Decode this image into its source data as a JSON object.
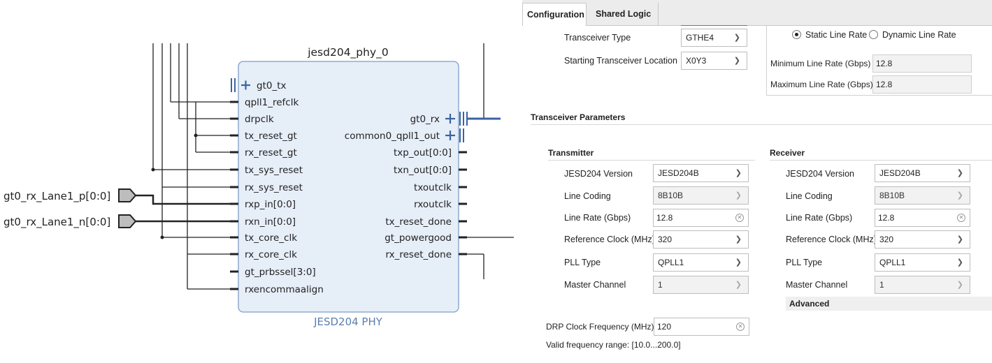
{
  "diagram": {
    "block_title": "jesd204_phy_0",
    "block_caption": "JESD204 PHY",
    "external_inputs": [
      "gt0_rx_Lane1_p[0:0]",
      "gt0_rx_Lane1_n[0:0]"
    ],
    "left_ports": [
      "gt0_tx",
      "qpll1_refclk",
      "drpclk",
      "tx_reset_gt",
      "rx_reset_gt",
      "tx_sys_reset",
      "rx_sys_reset",
      "rxp_in[0:0]",
      "rxn_in[0:0]",
      "tx_core_clk",
      "rx_core_clk",
      "gt_prbssel[3:0]",
      "rxencommaalign"
    ],
    "right_ports": [
      "gt0_rx",
      "common0_qpll1_out",
      "txp_out[0:0]",
      "txn_out[0:0]",
      "txoutclk",
      "rxoutclk",
      "tx_reset_done",
      "gt_powergood",
      "rx_reset_done"
    ],
    "colors": {
      "block_fill": "#e6eef8",
      "block_border": "#7f9fc6",
      "bus": "#3a63a3",
      "wire": "#222222",
      "caption": "#5b7fb0"
    }
  },
  "panel": {
    "tabs": [
      "Configuration",
      "Shared Logic"
    ],
    "transceiver_type_label": "Transceiver Type",
    "transceiver_type_value": "GTHE4",
    "start_location_label": "Starting Transceiver Location",
    "start_location_value": "X0Y3",
    "static_line_rate": "Static Line Rate",
    "dynamic_line_rate": "Dynamic Line Rate",
    "min_rate_label": "Minimum Line Rate (Gbps)",
    "min_rate_value": "12.8",
    "max_rate_label": "Maximum Line Rate (Gbps)",
    "max_rate_value": "12.8",
    "params_title": "Transceiver Parameters",
    "tx": {
      "title": "Transmitter",
      "rows": [
        {
          "label": "JESD204 Version",
          "value": "JESD204B"
        },
        {
          "label": "Line Coding",
          "value": "8B10B"
        },
        {
          "label": "Line Rate (Gbps)",
          "value": "12.8"
        },
        {
          "label": "Reference Clock (MHz)",
          "value": "320"
        },
        {
          "label": "PLL Type",
          "value": "QPLL1"
        },
        {
          "label": "Master Channel",
          "value": "1"
        }
      ]
    },
    "rx": {
      "title": "Receiver",
      "rows": [
        {
          "label": "JESD204 Version",
          "value": "JESD204B"
        },
        {
          "label": "Line Coding",
          "value": "8B10B"
        },
        {
          "label": "Line Rate (Gbps)",
          "value": "12.8"
        },
        {
          "label": "Reference Clock (MHz)",
          "value": "320"
        },
        {
          "label": "PLL Type",
          "value": "QPLL1"
        },
        {
          "label": "Master Channel",
          "value": "1"
        }
      ]
    },
    "advanced": "Advanced",
    "drp_label": "DRP Clock Frequency (MHz)",
    "drp_value": "120",
    "drp_range": "Valid frequency range: [10.0...200.0]",
    "icons": {
      "dropdown": "chevron-down-icon",
      "clear": "clear-circle-icon",
      "radio": "radio-icon"
    }
  }
}
